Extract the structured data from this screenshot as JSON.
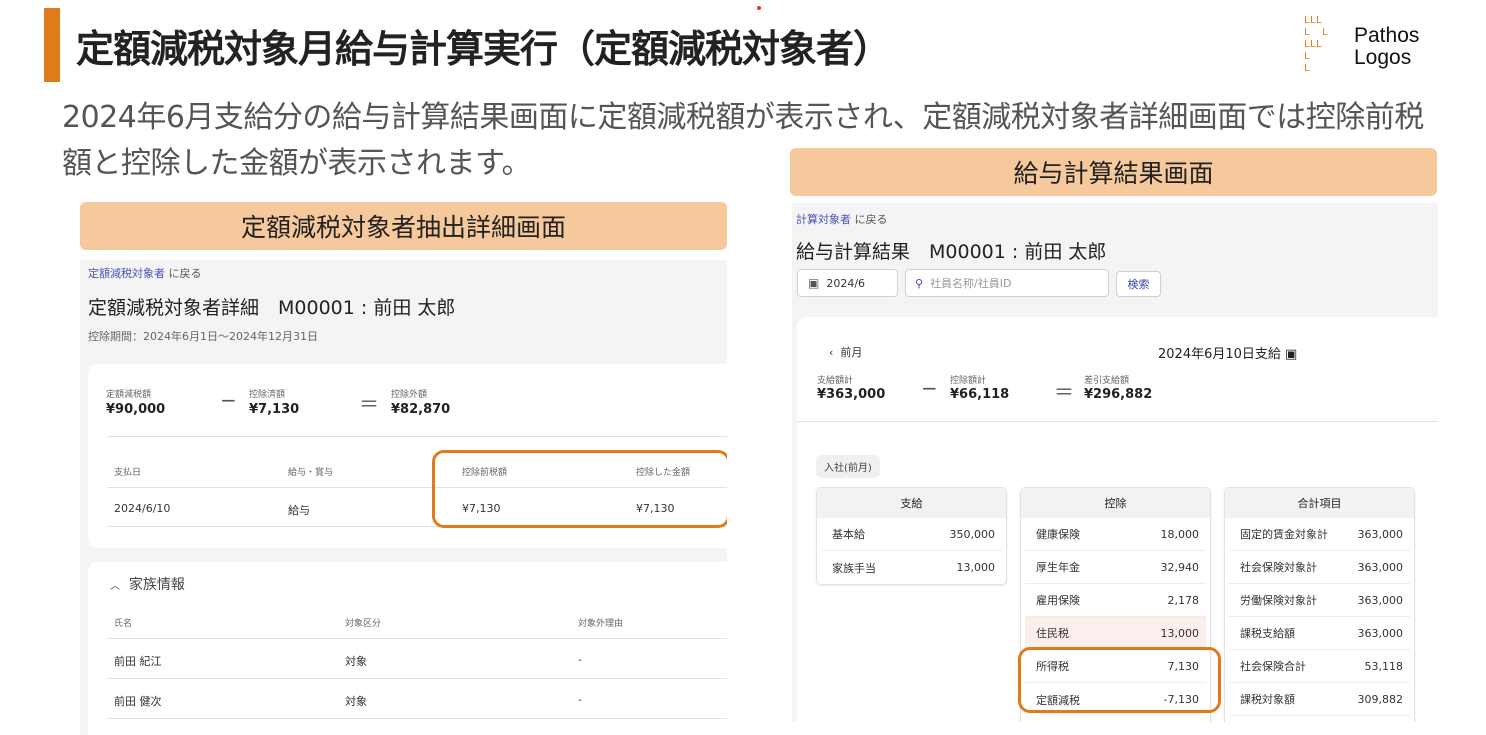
{
  "slide": {
    "title": "定額減税対象月給与計算実行（定額減税対象者）",
    "subtitle": "2024年6月支給分の給与計算結果画面に定額減税額が表示され、定額減税対象者詳細画面では控除前税額と控除した金額が表示されます。",
    "logo": {
      "line1": "Pathos",
      "line2": "Logos"
    },
    "accent": "#e07b1a",
    "label_right": "給与計算結果画面",
    "label_left": "定額減税対象者抽出詳細画面"
  },
  "left": {
    "back_link": "定額減税対象者",
    "back_suffix": "に戻る",
    "title": "定額減税対象者詳細　M00001 : 前田 太郎",
    "period": "控除期間：2024年6月1日～2024年12月31日",
    "summary": [
      {
        "label": "定額減税額",
        "value": "¥90,000"
      },
      {
        "op": "−"
      },
      {
        "label": "控除済額",
        "value": "¥7,130"
      },
      {
        "op": "＝"
      },
      {
        "label": "控除外額",
        "value": "¥82,870"
      }
    ],
    "table": {
      "headers": [
        "支払日",
        "給与・賞与",
        "控除前税額",
        "控除した金額"
      ],
      "rows": [
        [
          "2024/6/10",
          "給与",
          "¥7,130",
          "¥7,130"
        ]
      ]
    },
    "family": {
      "title": "家族情報",
      "headers": [
        "氏名",
        "対象区分",
        "対象外理由"
      ],
      "rows": [
        [
          "前田 紀江",
          "対象",
          "-"
        ],
        [
          "前田 健次",
          "対象",
          "-"
        ]
      ]
    }
  },
  "right": {
    "back_link": "計算対象者",
    "back_suffix": "に戻る",
    "title": "給与計算結果　M00001 : 前田 太郎",
    "date_value": "2024/6",
    "search_placeholder": "社員名称/社員ID",
    "search_button": "検索",
    "prev_month": "前月",
    "pay_date": "2024年6月10日支給",
    "summary": [
      {
        "label": "支給額計",
        "value": "¥363,000"
      },
      {
        "op": "−"
      },
      {
        "label": "控除額計",
        "value": "¥66,118"
      },
      {
        "op": "＝"
      },
      {
        "label": "差引支給額",
        "value": "¥296,882"
      }
    ],
    "badge": "入社(前月)",
    "tables": [
      {
        "title": "支給",
        "rows": [
          [
            "基本給",
            "350,000"
          ],
          [
            "家族手当",
            "13,000"
          ]
        ]
      },
      {
        "title": "控除",
        "rows": [
          [
            "健康保険",
            "18,000"
          ],
          [
            "厚生年金",
            "32,940"
          ],
          [
            "雇用保険",
            "2,178"
          ],
          [
            "住民税",
            "13,000"
          ],
          [
            "所得税",
            "7,130"
          ],
          [
            "定額減税",
            "-7,130"
          ]
        ]
      },
      {
        "title": "合計項目",
        "rows": [
          [
            "固定的賃金対象計",
            "363,000"
          ],
          [
            "社会保険対象計",
            "363,000"
          ],
          [
            "労働保険対象計",
            "363,000"
          ],
          [
            "課税支給額",
            "363,000"
          ],
          [
            "社会保険合計",
            "53,118"
          ],
          [
            "課税対象額",
            "309,882"
          ]
        ]
      }
    ]
  }
}
